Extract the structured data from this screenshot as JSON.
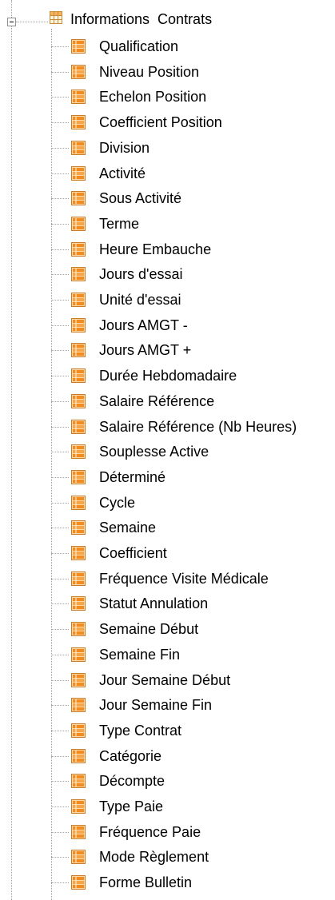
{
  "tree": {
    "root": {
      "label": "Informations  Contrats",
      "icon": "table-icon",
      "expanded": true
    },
    "items": [
      {
        "label": "Qualification",
        "icon": "field-icon"
      },
      {
        "label": "Niveau Position",
        "icon": "field-icon"
      },
      {
        "label": "Echelon Position",
        "icon": "field-icon"
      },
      {
        "label": "Coefficient Position",
        "icon": "field-icon"
      },
      {
        "label": "Division",
        "icon": "field-icon"
      },
      {
        "label": "Activité",
        "icon": "field-icon"
      },
      {
        "label": "Sous Activité",
        "icon": "field-icon"
      },
      {
        "label": "Terme",
        "icon": "field-icon"
      },
      {
        "label": "Heure Embauche",
        "icon": "field-icon"
      },
      {
        "label": "Jours d'essai",
        "icon": "field-icon"
      },
      {
        "label": "Unité d'essai",
        "icon": "field-icon"
      },
      {
        "label": "Jours AMGT -",
        "icon": "field-icon"
      },
      {
        "label": "Jours AMGT +",
        "icon": "field-icon"
      },
      {
        "label": "Durée Hebdomadaire",
        "icon": "field-icon"
      },
      {
        "label": "Salaire Référence",
        "icon": "field-icon"
      },
      {
        "label": "Salaire Référence (Nb Heures)",
        "icon": "field-icon"
      },
      {
        "label": "Souplesse Active",
        "icon": "field-icon"
      },
      {
        "label": "Déterminé",
        "icon": "field-icon"
      },
      {
        "label": "Cycle",
        "icon": "field-icon"
      },
      {
        "label": "Semaine",
        "icon": "field-icon"
      },
      {
        "label": "Coefficient",
        "icon": "field-icon"
      },
      {
        "label": "Fréquence Visite Médicale",
        "icon": "field-icon"
      },
      {
        "label": "Statut Annulation",
        "icon": "field-icon"
      },
      {
        "label": "Semaine Début",
        "icon": "field-icon"
      },
      {
        "label": "Semaine Fin",
        "icon": "field-icon"
      },
      {
        "label": "Jour Semaine Début",
        "icon": "field-icon"
      },
      {
        "label": "Jour Semaine Fin",
        "icon": "field-icon"
      },
      {
        "label": "Type Contrat",
        "icon": "field-icon"
      },
      {
        "label": "Catégorie",
        "icon": "field-icon"
      },
      {
        "label": "Décompte",
        "icon": "field-icon"
      },
      {
        "label": "Type Paie",
        "icon": "field-icon"
      },
      {
        "label": "Fréquence Paie",
        "icon": "field-icon"
      },
      {
        "label": "Mode Règlement",
        "icon": "field-icon"
      },
      {
        "label": "Forme Bulletin",
        "icon": "field-icon"
      }
    ]
  },
  "colors": {
    "connector": "#a0a0a0",
    "field_icon_orange": "#f28c1e",
    "field_icon_light": "#fbd9a6",
    "table_icon_border": "#c88a3a"
  }
}
